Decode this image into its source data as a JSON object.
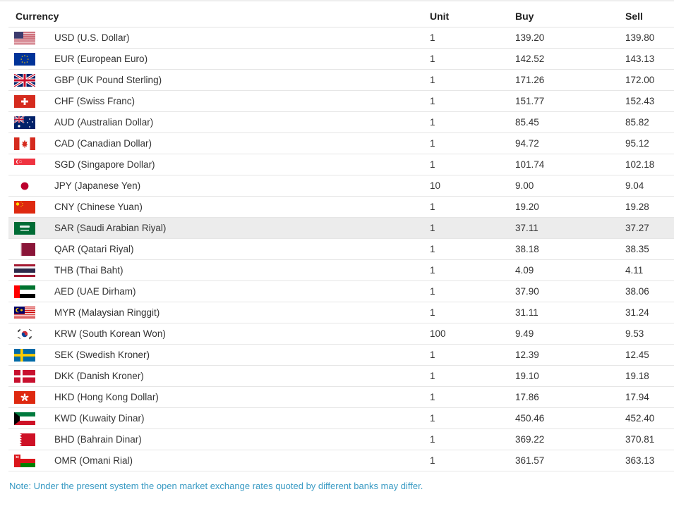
{
  "headers": {
    "currency": "Currency",
    "unit": "Unit",
    "buy": "Buy",
    "sell": "Sell"
  },
  "rows": [
    {
      "flag": "us-flag-icon",
      "currency": "USD (U.S. Dollar)",
      "unit": "1",
      "buy": "139.20",
      "sell": "139.80"
    },
    {
      "flag": "eu-flag-icon",
      "currency": "EUR (European Euro)",
      "unit": "1",
      "buy": "142.52",
      "sell": "143.13"
    },
    {
      "flag": "gb-flag-icon",
      "currency": "GBP (UK Pound Sterling)",
      "unit": "1",
      "buy": "171.26",
      "sell": "172.00"
    },
    {
      "flag": "ch-flag-icon",
      "currency": "CHF (Swiss Franc)",
      "unit": "1",
      "buy": "151.77",
      "sell": "152.43"
    },
    {
      "flag": "au-flag-icon",
      "currency": "AUD (Australian Dollar)",
      "unit": "1",
      "buy": "85.45",
      "sell": "85.82"
    },
    {
      "flag": "ca-flag-icon",
      "currency": "CAD (Canadian Dollar)",
      "unit": "1",
      "buy": "94.72",
      "sell": "95.12"
    },
    {
      "flag": "sg-flag-icon",
      "currency": "SGD (Singapore Dollar)",
      "unit": "1",
      "buy": "101.74",
      "sell": "102.18"
    },
    {
      "flag": "jp-flag-icon",
      "currency": "JPY (Japanese Yen)",
      "unit": "10",
      "buy": "9.00",
      "sell": "9.04"
    },
    {
      "flag": "cn-flag-icon",
      "currency": "CNY (Chinese Yuan)",
      "unit": "1",
      "buy": "19.20",
      "sell": "19.28"
    },
    {
      "flag": "sa-flag-icon",
      "currency": "SAR (Saudi Arabian Riyal)",
      "unit": "1",
      "buy": "37.11",
      "sell": "37.27",
      "highlighted": true
    },
    {
      "flag": "qa-flag-icon",
      "currency": "QAR (Qatari Riyal)",
      "unit": "1",
      "buy": "38.18",
      "sell": "38.35"
    },
    {
      "flag": "th-flag-icon",
      "currency": "THB (Thai Baht)",
      "unit": "1",
      "buy": "4.09",
      "sell": "4.11"
    },
    {
      "flag": "ae-flag-icon",
      "currency": "AED (UAE Dirham)",
      "unit": "1",
      "buy": "37.90",
      "sell": "38.06"
    },
    {
      "flag": "my-flag-icon",
      "currency": "MYR (Malaysian Ringgit)",
      "unit": "1",
      "buy": "31.11",
      "sell": "31.24"
    },
    {
      "flag": "kr-flag-icon",
      "currency": "KRW (South Korean Won)",
      "unit": "100",
      "buy": "9.49",
      "sell": "9.53"
    },
    {
      "flag": "se-flag-icon",
      "currency": "SEK (Swedish Kroner)",
      "unit": "1",
      "buy": "12.39",
      "sell": "12.45"
    },
    {
      "flag": "dk-flag-icon",
      "currency": "DKK (Danish Kroner)",
      "unit": "1",
      "buy": "19.10",
      "sell": "19.18"
    },
    {
      "flag": "hk-flag-icon",
      "currency": "HKD (Hong Kong Dollar)",
      "unit": "1",
      "buy": "17.86",
      "sell": "17.94"
    },
    {
      "flag": "kw-flag-icon",
      "currency": "KWD (Kuwaity Dinar)",
      "unit": "1",
      "buy": "450.46",
      "sell": "452.40"
    },
    {
      "flag": "bh-flag-icon",
      "currency": "BHD (Bahrain Dinar)",
      "unit": "1",
      "buy": "369.22",
      "sell": "370.81"
    },
    {
      "flag": "om-flag-icon",
      "currency": "OMR (Omani Rial)",
      "unit": "1",
      "buy": "361.57",
      "sell": "363.13"
    }
  ],
  "note": "Note: Under the present system the open market exchange rates quoted by different banks may differ.",
  "colors": {
    "note": "#3a9bc4",
    "highlight_row": "#ececec",
    "border": "#e6e6e6"
  }
}
